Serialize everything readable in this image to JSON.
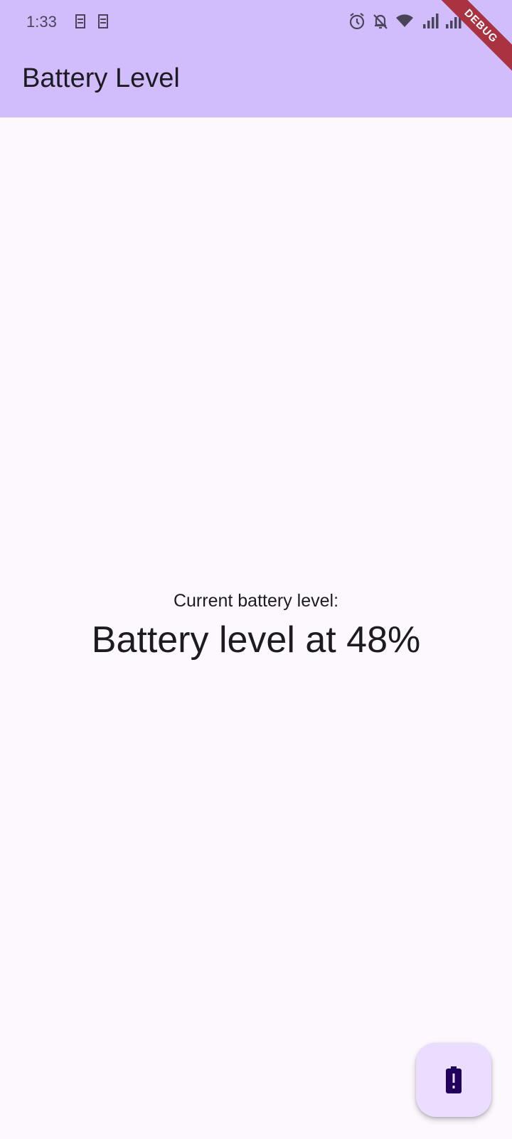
{
  "status_bar": {
    "time": "1:33",
    "left_icons": [
      "sim-icon",
      "sim-icon"
    ],
    "right_icons": [
      "alarm-icon",
      "notifications-off-icon",
      "wifi-icon",
      "signal-icon",
      "signal-icon",
      "battery-icon"
    ]
  },
  "app_bar": {
    "title": "Battery Level",
    "background": "#D2BDFC"
  },
  "debug_banner": {
    "label": "DEBUG",
    "color": "#A8323F"
  },
  "main": {
    "label": "Current battery level:",
    "value": "Battery level at 48%"
  },
  "fab": {
    "icon": "battery-alert-icon",
    "background": "#EADDFF"
  },
  "colors": {
    "page_background": "#FDF7FE",
    "text": "#1D1B20",
    "icon_dark": "#21005D"
  }
}
